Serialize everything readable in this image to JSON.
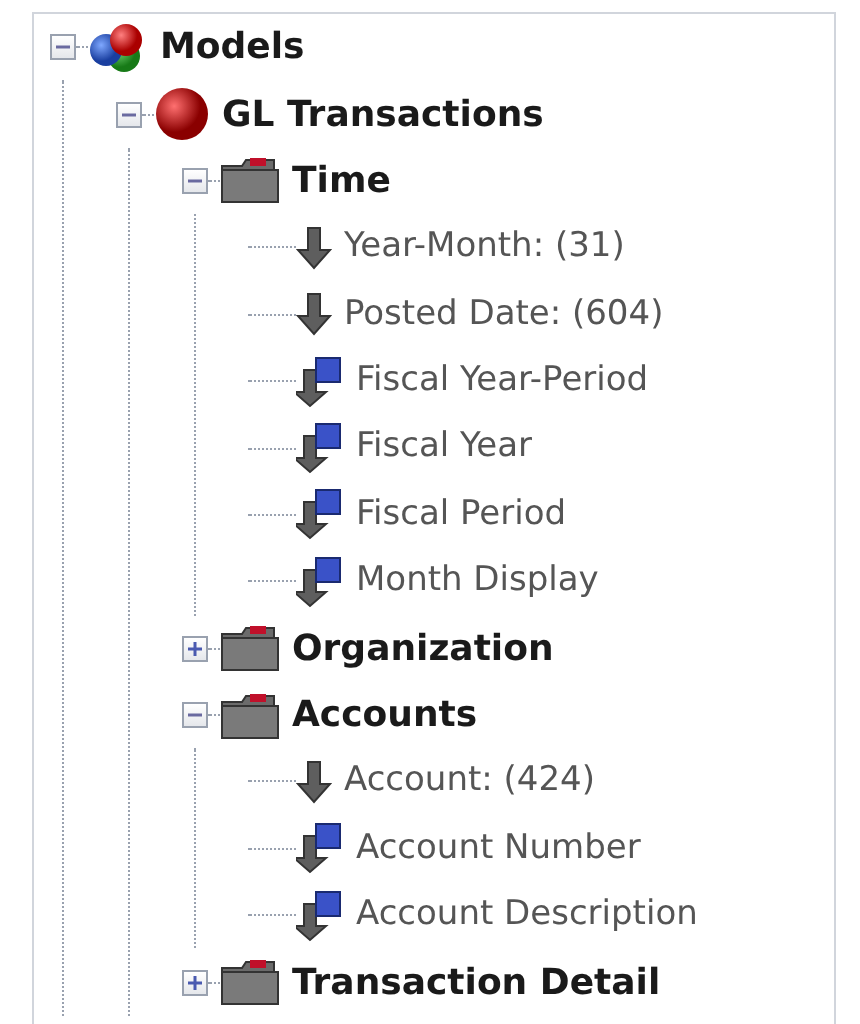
{
  "tree": [
    {
      "kind": "model-group",
      "label": "Models",
      "expanded": true,
      "children": [
        {
          "kind": "model",
          "label": "GL Transactions",
          "expanded": true,
          "children": [
            {
              "kind": "folder",
              "label": "Time",
              "expanded": true,
              "children": [
                {
                  "kind": "attribute",
                  "label": "Year-Month: (31)"
                },
                {
                  "kind": "attribute",
                  "label": "Posted Date: (604)"
                },
                {
                  "kind": "hierarchy",
                  "label": "Fiscal Year-Period"
                },
                {
                  "kind": "hierarchy",
                  "label": "Fiscal Year"
                },
                {
                  "kind": "hierarchy",
                  "label": "Fiscal Period"
                },
                {
                  "kind": "hierarchy",
                  "label": "Month Display"
                }
              ]
            },
            {
              "kind": "folder",
              "label": "Organization",
              "expanded": false
            },
            {
              "kind": "folder",
              "label": "Accounts",
              "expanded": true,
              "children": [
                {
                  "kind": "attribute",
                  "label": "Account: (424)"
                },
                {
                  "kind": "hierarchy",
                  "label": "Account Number"
                },
                {
                  "kind": "hierarchy",
                  "label": "Account Description"
                }
              ]
            },
            {
              "kind": "folder",
              "label": "Transaction Detail",
              "expanded": false
            }
          ]
        }
      ]
    }
  ]
}
